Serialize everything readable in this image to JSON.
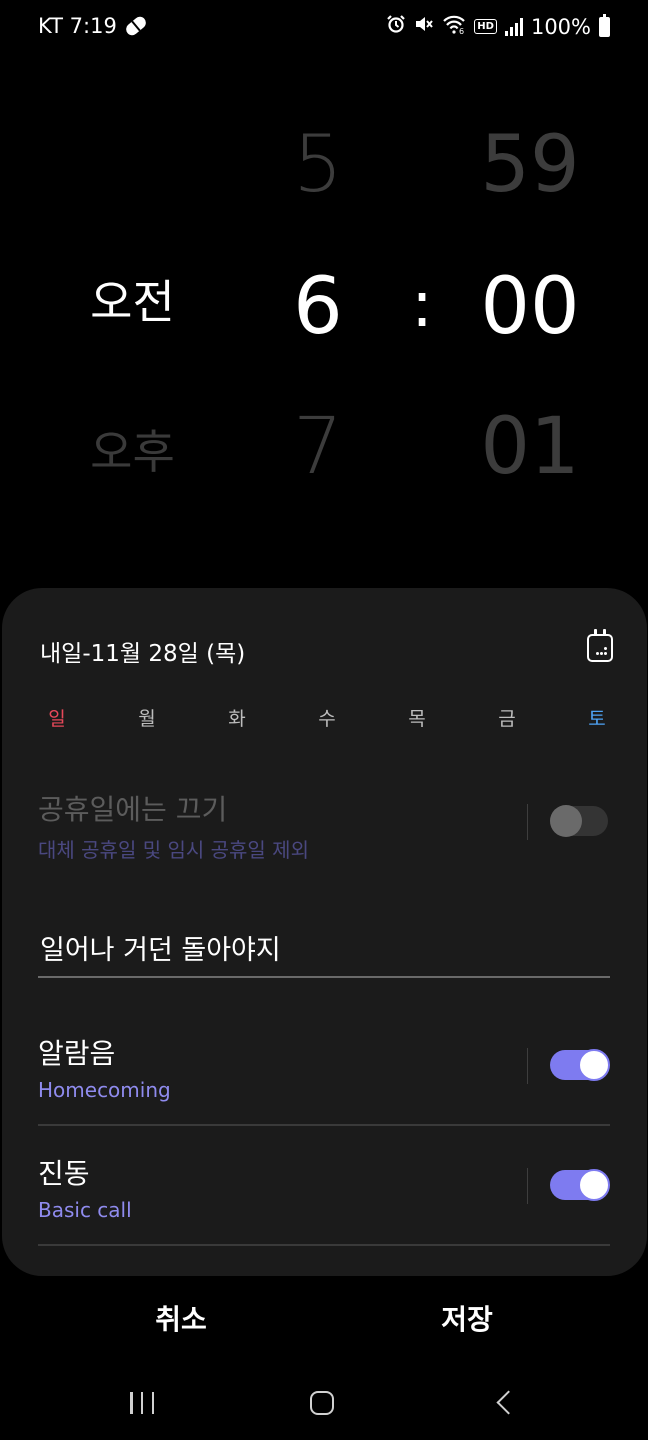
{
  "status_bar": {
    "carrier_time": "KT 7:19",
    "battery_text": "100%",
    "hd_label": "HD",
    "network_badge": "6",
    "icons": [
      "pill-icon",
      "alarm-icon",
      "mute-icon",
      "wifi-icon",
      "hd-icon",
      "signal-icon",
      "battery-icon"
    ]
  },
  "picker": {
    "ampm_selected": "오전",
    "ampm_other": "오후",
    "hour_prev": "5",
    "hour_selected": "6",
    "hour_next": "7",
    "separator": ":",
    "minute_prev": "59",
    "minute_selected": "00",
    "minute_next": "01"
  },
  "card": {
    "date_label": "내일-11월 28일 (목)",
    "days": [
      "일",
      "월",
      "화",
      "수",
      "목",
      "금",
      "토"
    ],
    "holiday": {
      "title": "공휴일에는 끄기",
      "subtitle": "대체 공휴일 및 임시 공휴일 제외",
      "enabled": false
    },
    "alarm_name_value": "일어나 거던 돌아야지",
    "sound": {
      "title": "알람음",
      "subtitle": "Homecoming",
      "enabled": true
    },
    "vibration": {
      "title": "진동",
      "subtitle": "Basic call",
      "enabled": true
    }
  },
  "actions": {
    "cancel_label": "취소",
    "save_label": "저장"
  },
  "colors": {
    "accent": "#7e7bf0",
    "sunday": "#e8485a",
    "saturday": "#4ea3f5",
    "card_bg": "#1b1b1b"
  }
}
